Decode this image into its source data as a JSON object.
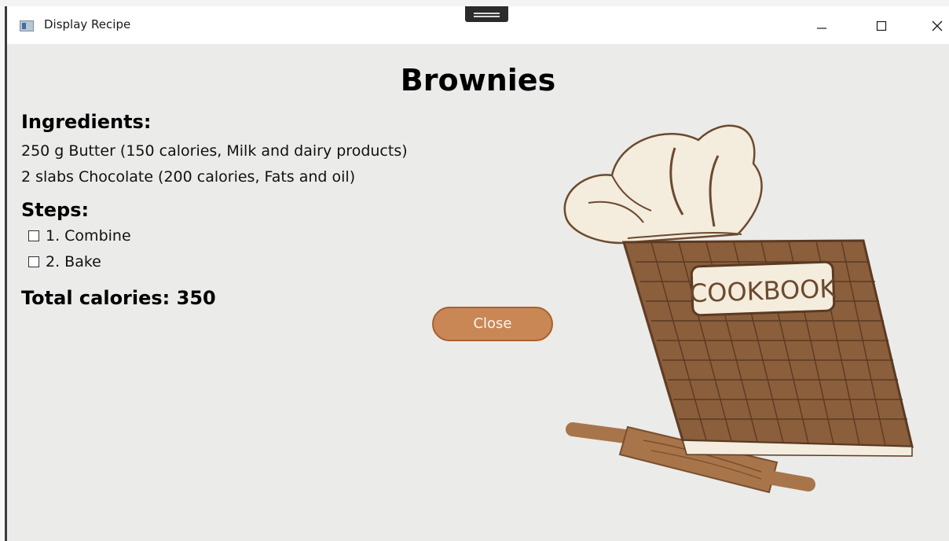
{
  "window": {
    "title": "Display Recipe",
    "icon": "app-window-icon"
  },
  "titlebar_buttons": [
    {
      "name": "minimize",
      "icon": "minimize-icon"
    },
    {
      "name": "maximize",
      "icon": "maximize-icon"
    },
    {
      "name": "close",
      "icon": "close-icon"
    }
  ],
  "recipe": {
    "name": "Brownies",
    "ingredients_heading": "Ingredients:",
    "ingredients": [
      "250 g Butter (150 calories, Milk and dairy products)",
      "2 slabs Chocolate (200 calories, Fats and oil)"
    ],
    "steps_heading": "Steps:",
    "steps": [
      {
        "label": "1. Combine",
        "checked": false
      },
      {
        "label": "2. Bake",
        "checked": false
      }
    ],
    "total_calories": "Total calories: 350"
  },
  "actions": {
    "close_label": "Close"
  },
  "illustration": {
    "book_label": "COOKBOOK",
    "icons": [
      "chef-hat-icon",
      "cookbook-icon",
      "rolling-pin-icon"
    ]
  },
  "colors": {
    "window_bg": "#ebebe9",
    "button_fill": "#c98756",
    "button_border": "#a8602f",
    "book_brown": "#8b5e3c"
  }
}
